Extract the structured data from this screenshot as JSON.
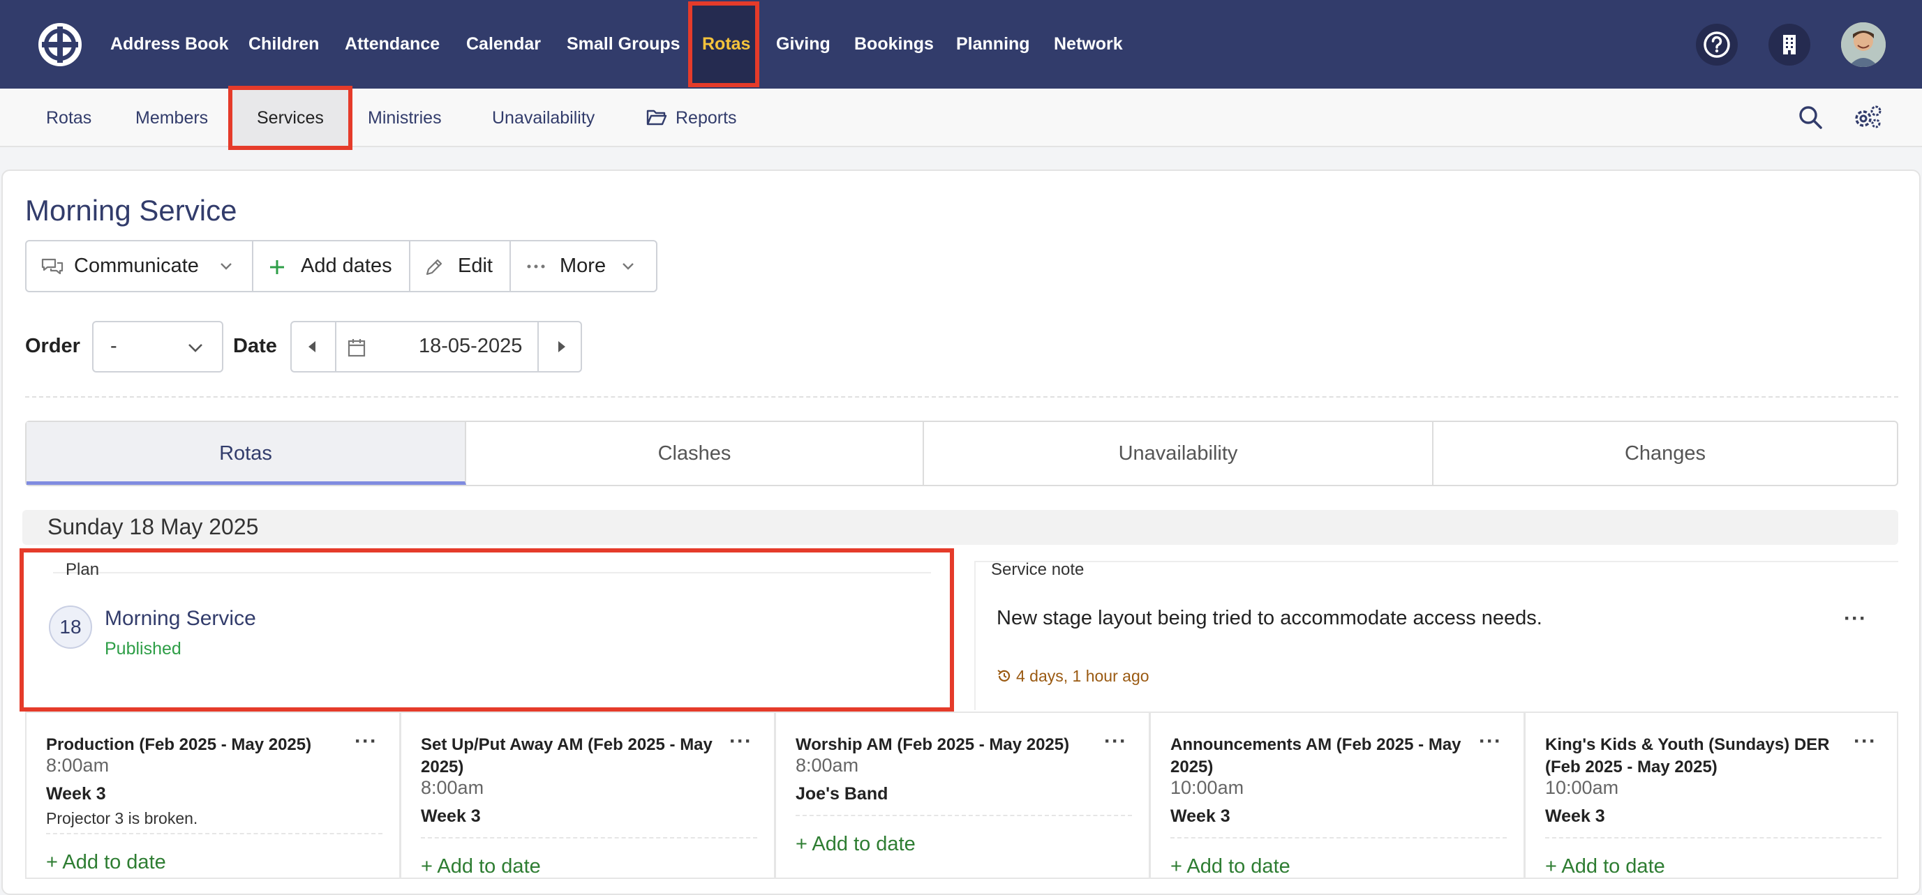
{
  "topnav": {
    "items": [
      "Address Book",
      "Children",
      "Attendance",
      "Calendar",
      "Small Groups",
      "Rotas",
      "Giving",
      "Bookings",
      "Planning",
      "Network"
    ],
    "active": "Rotas"
  },
  "subnav": {
    "items": [
      "Rotas",
      "Members",
      "Services",
      "Ministries",
      "Unavailability",
      "Reports"
    ],
    "active": "Services"
  },
  "page": {
    "title": "Morning Service",
    "buttons": {
      "communicate": "Communicate",
      "add_dates": "Add dates",
      "edit": "Edit",
      "more": "More"
    },
    "order_label": "Order",
    "order_value": "-",
    "date_label": "Date",
    "date_value": "18-05-2025"
  },
  "tabs": [
    "Rotas",
    "Clashes",
    "Unavailability",
    "Changes"
  ],
  "active_tab": "Rotas",
  "day": {
    "header": "Sunday 18 May 2025",
    "plan": {
      "label": "Plan",
      "day_number": "18",
      "name": "Morning Service",
      "status": "Published"
    },
    "service_note": {
      "label": "Service note",
      "text": "New stage layout being tried to accommodate access needs.",
      "updated": "4 days, 1 hour ago"
    }
  },
  "rota_cards": [
    {
      "title": "Production (Feb 2025 - May 2025)",
      "time": "8:00am",
      "week": "Week 3",
      "note": "Projector 3 is broken.",
      "add": "Add to date"
    },
    {
      "title": "Set Up/Put Away AM (Feb 2025 - May 2025)",
      "time": "8:00am",
      "week": "Week 3",
      "note": "",
      "add": "Add to date"
    },
    {
      "title": "Worship AM (Feb 2025 - May 2025)",
      "time": "8:00am",
      "week": "Joe's Band",
      "note": "",
      "add": "Add to date"
    },
    {
      "title": "Announcements AM (Feb 2025 - May 2025)",
      "time": "10:00am",
      "week": "Week 3",
      "note": "",
      "add": "Add to date"
    },
    {
      "title": "King's Kids & Youth (Sundays) DER (Feb 2025 - May 2025)",
      "time": "10:00am",
      "week": "Week 3",
      "note": "",
      "add": "Add to date"
    }
  ],
  "colors": {
    "nav_bg": "#323c6b",
    "active_nav": "#f5c33b",
    "highlight": "#e53b2a",
    "success": "#2e7d32",
    "note_time": "#9a5a12"
  }
}
